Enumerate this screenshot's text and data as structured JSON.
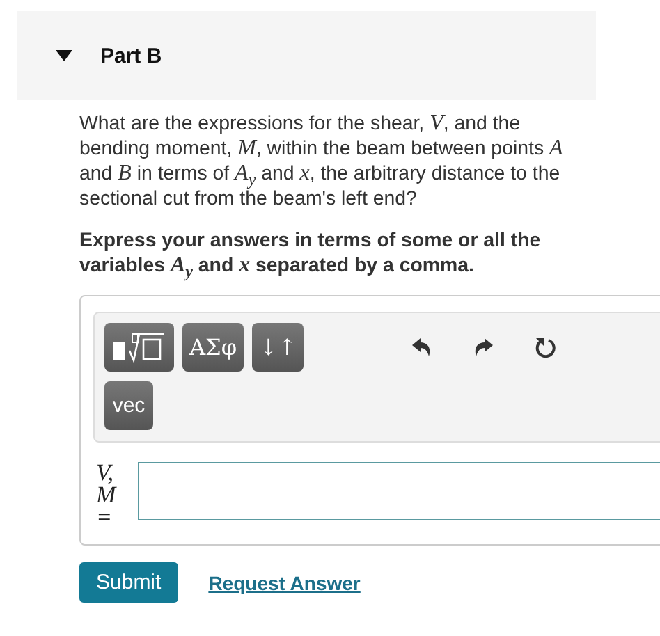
{
  "part": {
    "title": "Part B",
    "expanded": true
  },
  "question": "What are the expressions for the shear, *V*, and the bending moment, *M*, within the beam between points *A* and *B* in terms of *A*$_{y}$ and *x*, the arbitrary distance to the sectional cut from the beam's left end?",
  "instruction": "Express your answers in terms of some or all the variables *A*$_{y}$ and *x* separated by a comma.",
  "toolbar": [
    {
      "kind": "templates"
    },
    {
      "kind": "text",
      "label": "ΑΣφ"
    },
    {
      "kind": "text",
      "label": "↓↑"
    },
    {
      "kind": "undo"
    },
    {
      "kind": "redo"
    },
    {
      "kind": "reset"
    },
    {
      "kind": "text",
      "label": "vec"
    }
  ],
  "answer": {
    "label": "V, M ="
  },
  "buttons": {
    "submit": "Submit",
    "request": "Request Answer"
  }
}
